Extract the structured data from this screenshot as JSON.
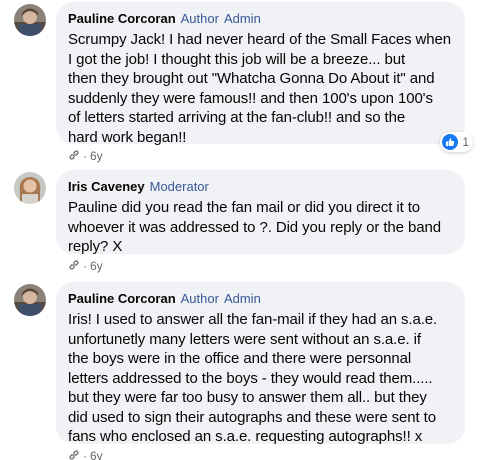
{
  "colors": {
    "bubble": "#f0f2f5",
    "badge": "#385898",
    "like": "#1877f2",
    "muted": "#65676b"
  },
  "comments": [
    {
      "author": "Pauline Corcoran",
      "badges": [
        "Author",
        "Admin"
      ],
      "text": "Scrumpy Jack! I had never heard of the Small Faces when\nI got the job! I thought this job will be a breeze... but\nthen they brought out \"Whatcha Gonna Do About it\" and\nsuddenly they were famous!! and then 100's upon 100's\nof letters started arriving at the fan-club!! and so the\nhard work began!!",
      "time": "6y",
      "reaction": {
        "icon": "like-icon",
        "count": "1"
      }
    },
    {
      "author": "Iris Caveney",
      "badges": [
        "Moderator"
      ],
      "text": "Pauline did you read the fan mail or did you direct it to\nwhoever it was addressed to ?. Did you reply or the band\nreply? X",
      "time": "6y"
    },
    {
      "author": "Pauline Corcoran",
      "badges": [
        "Author",
        "Admin"
      ],
      "text": "Iris! I used to answer all the fan-mail if they had an s.a.e.\nunfortunetly many letters were sent without an s.a.e. if\nthe boys were in the office and there were personnal\nletters addressed to the boys - they would read them.....\nbut they were far too busy to answer them all.. but they\ndid used to sign their autographs and these were sent to\nfans who enclosed an s.a.e. requesting autographs!! x",
      "time": "6y"
    }
  ]
}
